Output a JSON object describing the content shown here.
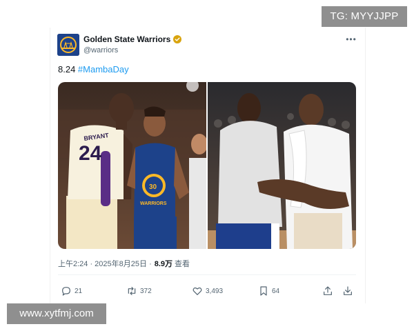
{
  "watermarks": {
    "top_right": "TG: MYYJJPP",
    "bottom_left": "www.xytfmj.com"
  },
  "tweet": {
    "display_name": "Golden State Warriors",
    "handle": "@warriors",
    "text_prefix": "8.24 ",
    "hashtag": "#MambaDay",
    "timestamp": "上午2:24 · 2025年8月25日 · ",
    "views_count": "8.9万",
    "views_label": "查看",
    "stats": {
      "replies": "21",
      "retweets": "372",
      "likes": "3,493",
      "bookmarks": "64"
    },
    "photo_text": {
      "jersey_left_name": "BRYANT",
      "jersey_left_number": "24",
      "jersey_center_number": "30",
      "jersey_center_name": "WARRIORS"
    }
  },
  "colors": {
    "accent": "#1d9bf0",
    "badge_gold": "#d9a40e",
    "warriors_blue": "#1d428a",
    "warriors_gold": "#fdb927",
    "lakers_purple": "#552583",
    "lakers_gold": "#fdb927"
  },
  "icons": {
    "verified": "verified-badge-icon",
    "more": "more-icon",
    "reply": "reply-icon",
    "retweet": "retweet-icon",
    "like": "heart-icon",
    "bookmark": "bookmark-icon",
    "share": "share-icon",
    "download": "download-icon"
  }
}
